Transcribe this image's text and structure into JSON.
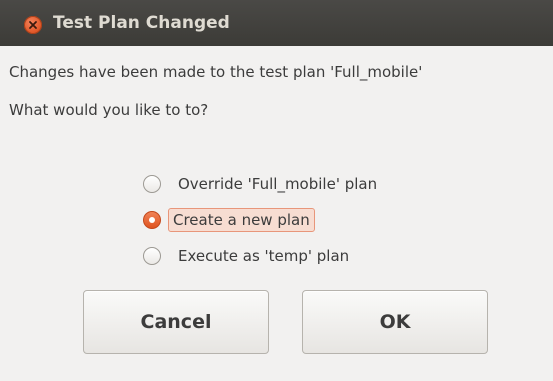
{
  "window": {
    "title": "Test Plan Changed",
    "close_icon": "close-icon"
  },
  "message": {
    "line1": "Changes have been made to the test plan 'Full_mobile'",
    "line2": "What would you like to to?"
  },
  "options": [
    {
      "label": "Override 'Full_mobile' plan",
      "checked": false
    },
    {
      "label": "Create a new plan",
      "checked": true
    },
    {
      "label": "Execute as 'temp' plan",
      "checked": false
    }
  ],
  "buttons": {
    "cancel": "Cancel",
    "ok": "OK"
  },
  "colors": {
    "titlebar": "#3c3b37",
    "title_text": "#dfdbd2",
    "accent": "#e0541f",
    "dialog_bg": "#f2f1f0",
    "focus_bg": "#f7ddd2"
  }
}
